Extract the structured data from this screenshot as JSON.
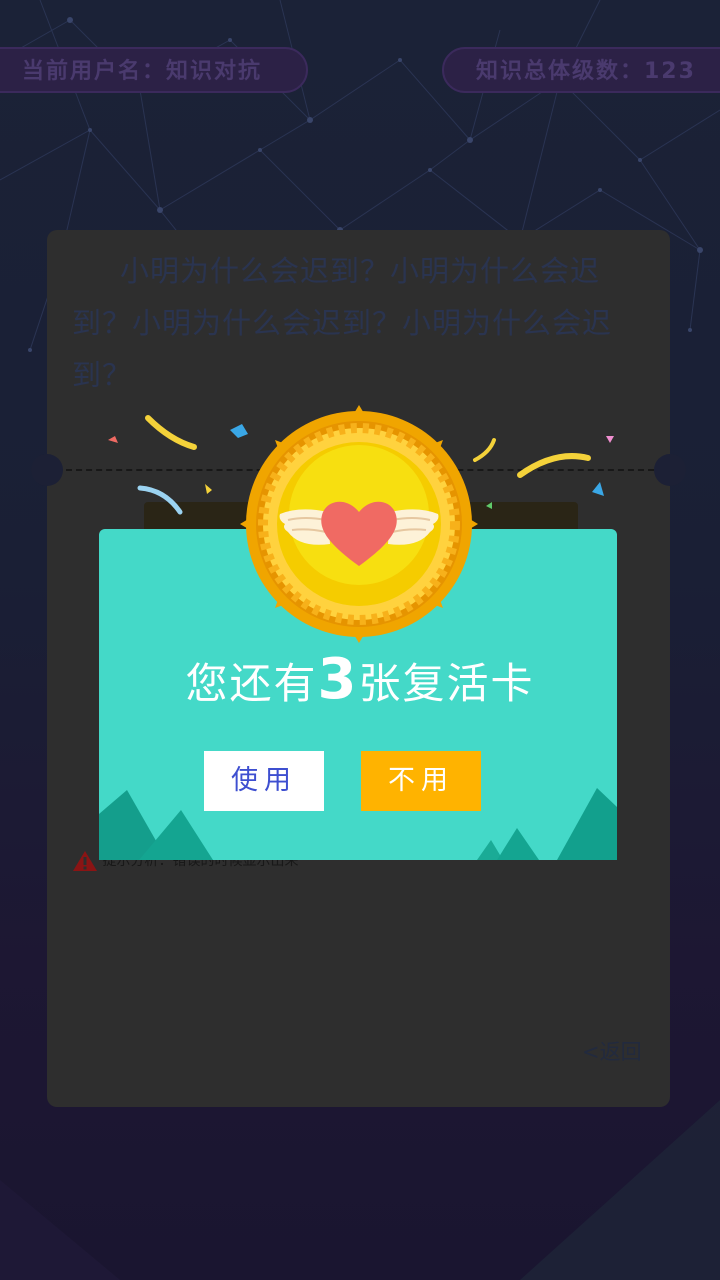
{
  "header": {
    "username_label": "当前用户名：知识对抗",
    "level_label": "知识总体级数：123"
  },
  "question": {
    "text": "小明为什么会迟到？小明为什么会迟到？小明为什么会迟到？小明为什么会迟到？"
  },
  "hint": {
    "text": "提示分析：错误的时候显示出来"
  },
  "nav": {
    "back_label": "<返回"
  },
  "dialog": {
    "title_prefix": "您还有",
    "count": "3",
    "title_suffix": "张复活卡",
    "use_label": "使用",
    "no_use_label": "不用"
  },
  "colors": {
    "dialog_bg": "#44d9c8",
    "use_button_bg": "#ffffff",
    "no_use_button_bg": "#ffb300",
    "medal_gold": "#f2d000",
    "heart": "#f06a63"
  },
  "icons": {
    "medal": "heart-wings-medal-icon",
    "warning": "warning-icon"
  }
}
